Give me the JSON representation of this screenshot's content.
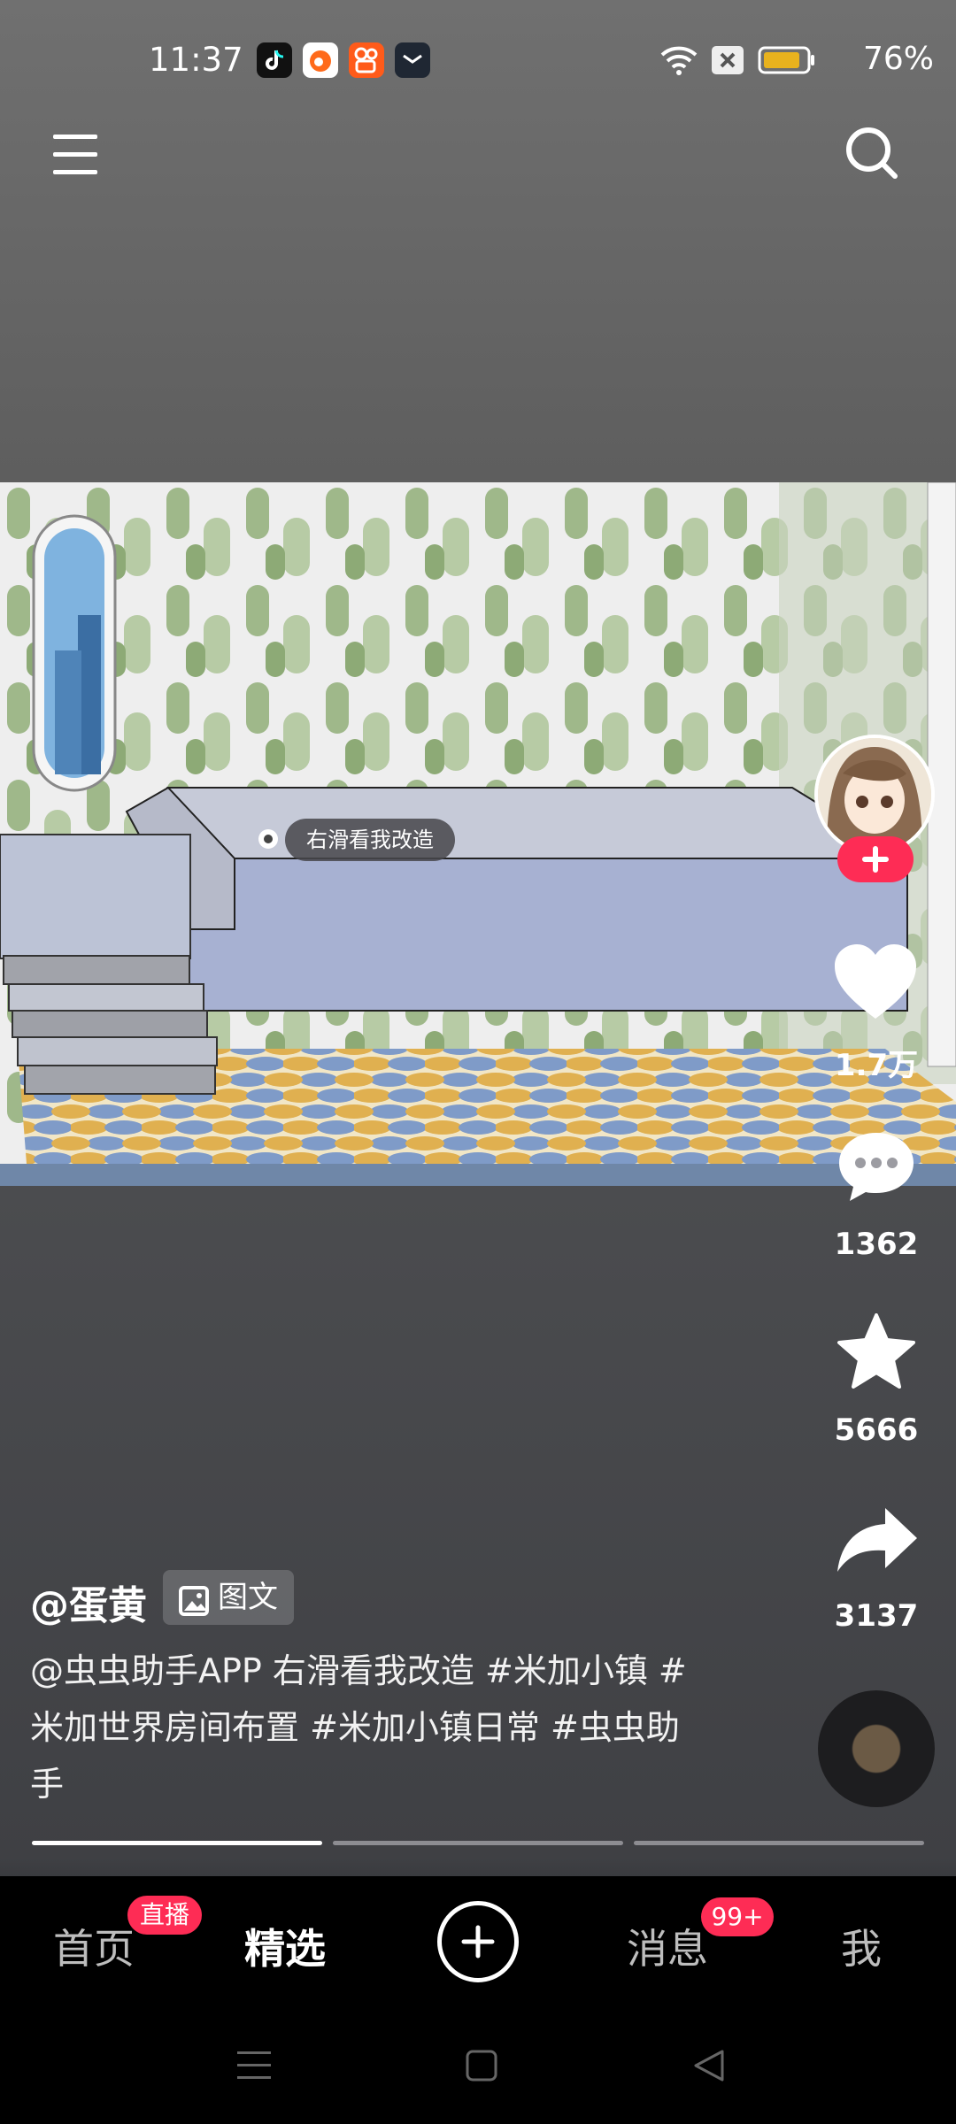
{
  "status_bar": {
    "time": "11:37",
    "battery": "76%",
    "icons": [
      "tiktok-app-icon",
      "weibo-app-icon",
      "kuaishou-app-icon",
      "mail-app-icon",
      "wifi-icon",
      "no-sim-icon",
      "battery-icon"
    ]
  },
  "top_bar": {
    "menu_icon": "menu-icon",
    "search_icon": "search-icon"
  },
  "post": {
    "swipe_hint": "右滑看我改造",
    "author": "@蛋黄",
    "type_badge": "图文",
    "caption": "@虫虫助手APP 右滑看我改造 #米加小镇 #米加世界房间布置 #米加小镇日常 #虫虫助手",
    "slides_total": 3,
    "slide_current": 1
  },
  "actions": {
    "likes": "1.7万",
    "comments": "1362",
    "favorites": "5666",
    "shares": "3137"
  },
  "nav": {
    "home": "首页",
    "home_badge": "直播",
    "featured": "精选",
    "messages": "消息",
    "messages_badge": "99+",
    "me": "我"
  },
  "colors": {
    "accent": "#fe2c55",
    "battery": "#e8b21e"
  }
}
